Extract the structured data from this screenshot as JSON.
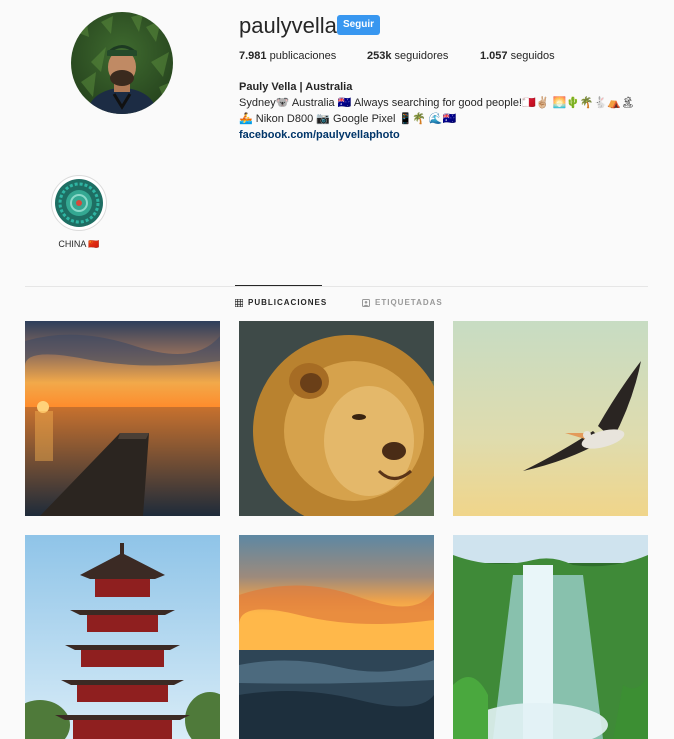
{
  "profile": {
    "username": "paulyvella",
    "follow_label": "Seguir",
    "stats": {
      "posts_value": "7.981",
      "posts_label": "publicaciones",
      "followers_value": "253k",
      "followers_label": "seguidores",
      "following_value": "1.057",
      "following_label": "seguidos"
    },
    "bio": {
      "name": "Pauly Vella | Australia",
      "line1": "Sydney🐨 Australia 🇦🇺 Always searching for good people!🇲🇹✌🏼 🌅🌵🌴🐇⛺🏝",
      "line2": "🚣 Nikon D800 📷 Google Pixel 📱🌴 🌊🇦🇺",
      "link": "facebook.com/paulyvellaphoto"
    }
  },
  "highlights": [
    {
      "label": "CHINA 🇨🇳"
    }
  ],
  "tabs": [
    {
      "label": "PUBLICACIONES",
      "icon": "grid-icon",
      "active": true
    },
    {
      "label": "ETIQUETADAS",
      "icon": "tag-icon",
      "active": false
    }
  ],
  "posts": [
    {
      "subject": "sunset-pier"
    },
    {
      "subject": "lion"
    },
    {
      "subject": "pelican"
    },
    {
      "subject": "pagoda"
    },
    {
      "subject": "ocean-sunset"
    },
    {
      "subject": "waterfall"
    }
  ]
}
